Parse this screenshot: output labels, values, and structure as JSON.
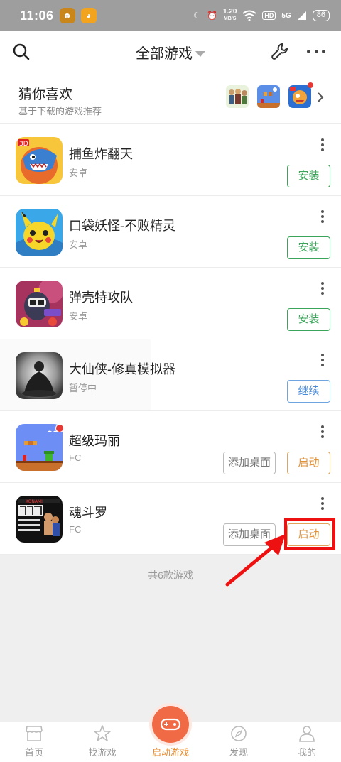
{
  "status_bar": {
    "time": "11:06",
    "speed_value": "1.20",
    "speed_unit": "MB/S",
    "hd": "HD",
    "network": "5G",
    "battery": "86"
  },
  "header": {
    "title": "全部游戏"
  },
  "recommend": {
    "title": "猜你喜欢",
    "subtitle": "基于下载的游戏推荐"
  },
  "games": [
    {
      "name": "捕鱼炸翻天",
      "platform": "安卓",
      "action": "安装"
    },
    {
      "name": "口袋妖怪-不败精灵",
      "platform": "安卓",
      "action": "安装"
    },
    {
      "name": "弹壳特攻队",
      "platform": "安卓",
      "action": "安装"
    },
    {
      "name": "大仙侠-修真模拟器",
      "platform": "暂停中",
      "action": "继续"
    },
    {
      "name": "超级玛丽",
      "platform": "FC",
      "secondary_action": "添加桌面",
      "action": "启动"
    },
    {
      "name": "魂斗罗",
      "platform": "FC",
      "secondary_action": "添加桌面",
      "action": "启动"
    }
  ],
  "total_text": "共6款游戏",
  "bottom_nav": [
    {
      "label": "首页",
      "icon": "store-icon"
    },
    {
      "label": "找游戏",
      "icon": "star-icon"
    },
    {
      "label": "启动游戏",
      "icon": "gamepad-icon",
      "active": true
    },
    {
      "label": "发现",
      "icon": "compass-icon"
    },
    {
      "label": "我的",
      "icon": "person-icon"
    }
  ],
  "colors": {
    "install": "#3aa55a",
    "continue": "#4a8ad6",
    "launch": "#e0923a",
    "highlight": "#ee1111",
    "active_nav": "#e98b2a",
    "center_button": "#f06b45"
  }
}
